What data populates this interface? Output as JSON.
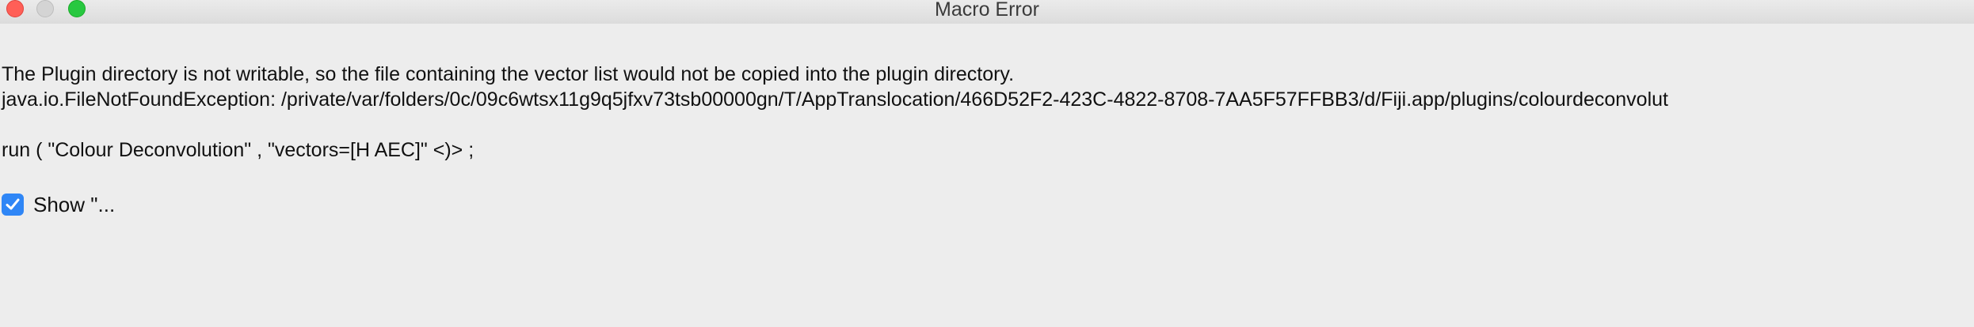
{
  "window": {
    "title": "Macro Error"
  },
  "message": {
    "line1": "The Plugin directory is not writable, so the file containing the vector list would not be copied into the plugin directory.",
    "line2": "java.io.FileNotFoundException: /private/var/folders/0c/09c6wtsx11g9q5jfxv73tsb00000gn/T/AppTranslocation/466D52F2-423C-4822-8708-7AA5F57FFBB3/d/Fiji.app/plugins/colourdeconvolut",
    "line3": "run ( \"Colour Deconvolution\" , \"vectors=[H AEC]\" <)> ;"
  },
  "checkbox": {
    "label": "Show \"...",
    "checked": true,
    "accent": "#2f86f6"
  },
  "colors": {
    "close": "#ff5f57",
    "minimize": "#d4d4d4",
    "zoom": "#28c840"
  }
}
